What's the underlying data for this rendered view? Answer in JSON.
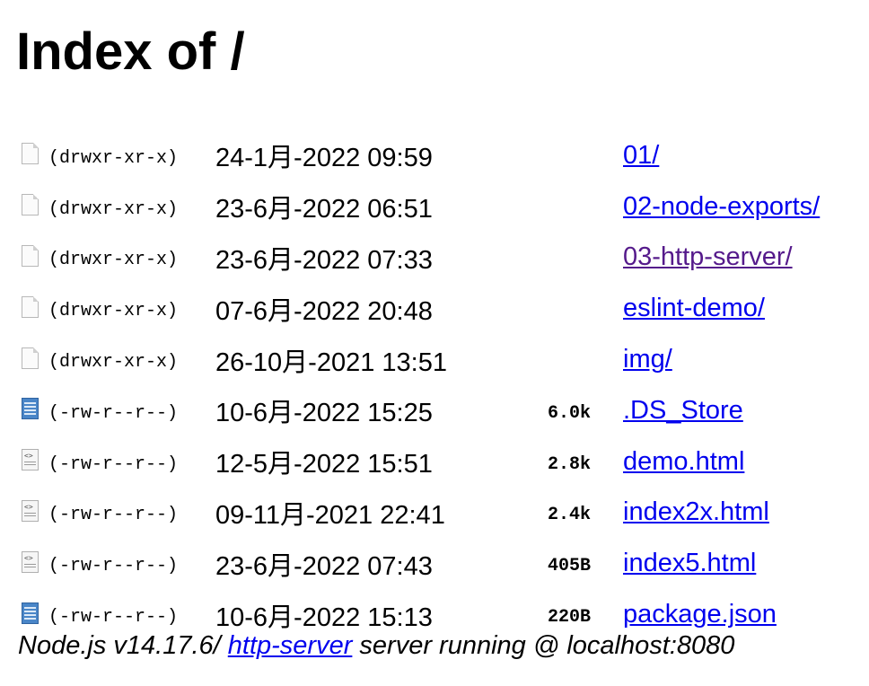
{
  "page": {
    "heading": "Index of /"
  },
  "entries": [
    {
      "icon": "folder-icon",
      "perms": "(drwxr-xr-x)",
      "date": "24-1月-2022 09:59",
      "size": "",
      "name": "01/",
      "visited": false
    },
    {
      "icon": "folder-icon",
      "perms": "(drwxr-xr-x)",
      "date": "23-6月-2022 06:51",
      "size": "",
      "name": "02-node-exports/",
      "visited": false
    },
    {
      "icon": "folder-icon",
      "perms": "(drwxr-xr-x)",
      "date": "23-6月-2022 07:33",
      "size": "",
      "name": "03-http-server/",
      "visited": true
    },
    {
      "icon": "folder-icon",
      "perms": "(drwxr-xr-x)",
      "date": "07-6月-2022 20:48",
      "size": "",
      "name": "eslint-demo/",
      "visited": false
    },
    {
      "icon": "folder-icon",
      "perms": "(drwxr-xr-x)",
      "date": "26-10月-2021 13:51",
      "size": "",
      "name": "img/",
      "visited": false
    },
    {
      "icon": "data-file-icon",
      "perms": "(-rw-r--r--)",
      "date": "10-6月-2022 15:25",
      "size": "6.0k",
      "name": ".DS_Store",
      "visited": false
    },
    {
      "icon": "html-file-icon",
      "perms": "(-rw-r--r--)",
      "date": "12-5月-2022 15:51",
      "size": "2.8k",
      "name": "demo.html",
      "visited": false
    },
    {
      "icon": "html-file-icon",
      "perms": "(-rw-r--r--)",
      "date": "09-11月-2021 22:41",
      "size": "2.4k",
      "name": "index2x.html",
      "visited": false
    },
    {
      "icon": "html-file-icon",
      "perms": "(-rw-r--r--)",
      "date": "23-6月-2022 07:43",
      "size": "405B",
      "name": "index5.html",
      "visited": false
    },
    {
      "icon": "data-file-icon",
      "perms": "(-rw-r--r--)",
      "date": "10-6月-2022 15:13",
      "size": "220B",
      "name": "package.json",
      "visited": false
    }
  ],
  "footer": {
    "prefix": "Node.js v14.17.6/ ",
    "link_text": "http-server",
    "suffix": " server running @ localhost:8080"
  },
  "colors": {
    "link": "#0000ee",
    "visited_link": "#551a8b",
    "text": "#000000",
    "background": "#ffffff"
  }
}
